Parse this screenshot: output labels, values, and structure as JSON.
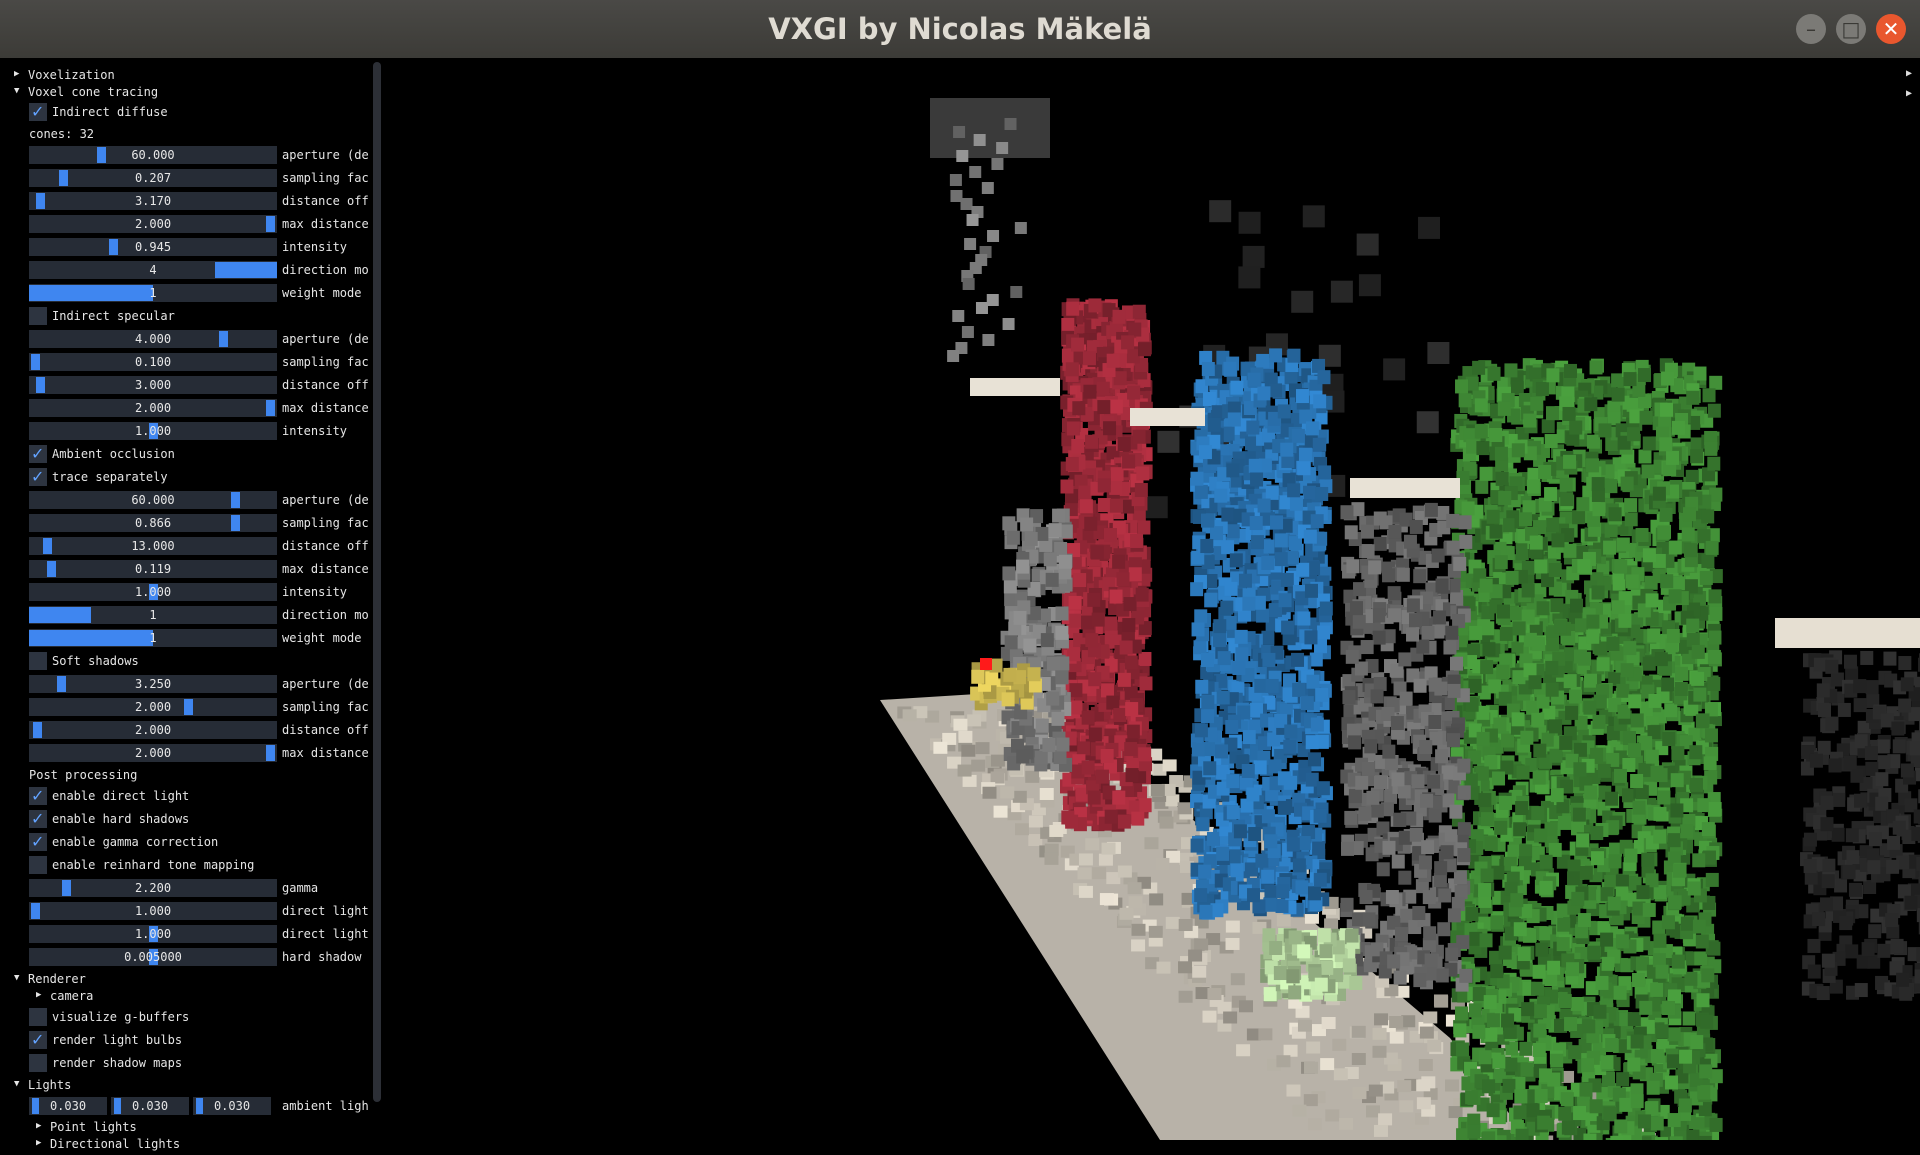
{
  "window": {
    "title": "VXGI by Nicolas Mäkelä"
  },
  "colors": {
    "accent": "#3f86f0",
    "check": "#63a3ff",
    "frame_bg": "#262c36",
    "close_button": "#e9572e"
  },
  "panel": {
    "voxelization": "Voxelization",
    "voxel_cone_tracing": "Voxel cone tracing",
    "indirect_diffuse": {
      "label": "Indirect diffuse",
      "checked": true,
      "cones_label": "cones: 32",
      "sliders": [
        {
          "value": "60.000",
          "label": "aperture (de",
          "fraction": 0.28
        },
        {
          "value": "0.207",
          "label": "sampling fac",
          "fraction": 0.12
        },
        {
          "value": "3.170",
          "label": "distance off",
          "fraction": 0.02
        },
        {
          "value": "2.000",
          "label": "max distance",
          "fraction": 1.0
        },
        {
          "value": "0.945",
          "label": "intensity",
          "fraction": 0.33
        },
        {
          "value": "4",
          "label": "direction mo",
          "fill": 0.25,
          "align": "right"
        },
        {
          "value": "1",
          "label": "weight mode",
          "fill": 0.5
        }
      ]
    },
    "indirect_specular": {
      "label": "Indirect specular",
      "checked": false,
      "sliders": [
        {
          "value": "4.000",
          "label": "aperture (de",
          "fraction": 0.8
        },
        {
          "value": "0.100",
          "label": "sampling fac",
          "fraction": 0.0
        },
        {
          "value": "3.000",
          "label": "distance off",
          "fraction": 0.02
        },
        {
          "value": "2.000",
          "label": "max distance",
          "fraction": 1.0
        },
        {
          "value": "1.000",
          "label": "intensity",
          "fraction": 0.5
        }
      ]
    },
    "ambient_occlusion": {
      "label": "Ambient occlusion",
      "checked": true,
      "trace_separately": {
        "label": "trace separately",
        "checked": true
      },
      "sliders": [
        {
          "value": "60.000",
          "label": "aperture (de",
          "fraction": 0.85
        },
        {
          "value": "0.866",
          "label": "sampling fac",
          "fraction": 0.85
        },
        {
          "value": "13.000",
          "label": "distance off",
          "fraction": 0.05
        },
        {
          "value": "0.119",
          "label": "max distance",
          "fraction": 0.07
        },
        {
          "value": "1.000",
          "label": "intensity",
          "fraction": 0.5
        },
        {
          "value": "1",
          "label": "direction mo",
          "fill": 0.25
        },
        {
          "value": "1",
          "label": "weight mode",
          "fill": 0.5
        }
      ]
    },
    "soft_shadows": {
      "label": "Soft shadows",
      "checked": false,
      "sliders": [
        {
          "value": "3.250",
          "label": "aperture (de",
          "fraction": 0.11
        },
        {
          "value": "2.000",
          "label": "sampling fac",
          "fraction": 0.65
        },
        {
          "value": "2.000",
          "label": "distance off",
          "fraction": 0.01
        },
        {
          "value": "2.000",
          "label": "max distance",
          "fraction": 1.0
        }
      ]
    },
    "post_processing": {
      "label": "Post processing",
      "checks": [
        {
          "label": "enable direct light",
          "checked": true
        },
        {
          "label": "enable hard shadows",
          "checked": true
        },
        {
          "label": "enable gamma correction",
          "checked": true
        },
        {
          "label": "enable reinhard tone mapping",
          "checked": false
        }
      ],
      "sliders": [
        {
          "value": "2.200",
          "label": "gamma",
          "fraction": 0.13
        },
        {
          "value": "1.000",
          "label": "direct light",
          "fraction": 0.0
        },
        {
          "value": "1.000",
          "label": "direct light",
          "fraction": 0.5
        },
        {
          "value": "0.005000",
          "label": "hard shadow",
          "fraction": 0.5
        }
      ]
    },
    "renderer": {
      "label": "Renderer",
      "camera": "camera",
      "checks": [
        {
          "label": "visualize g-buffers",
          "checked": false
        },
        {
          "label": "render light bulbs",
          "checked": true
        },
        {
          "label": "render shadow maps",
          "checked": false
        }
      ]
    },
    "lights": {
      "label": "Lights",
      "ambient": [
        "0.030",
        "0.030",
        "0.030"
      ],
      "ambient_label": "ambient ligh",
      "point_lights": "Point lights",
      "directional_lights": "Directional lights"
    }
  }
}
